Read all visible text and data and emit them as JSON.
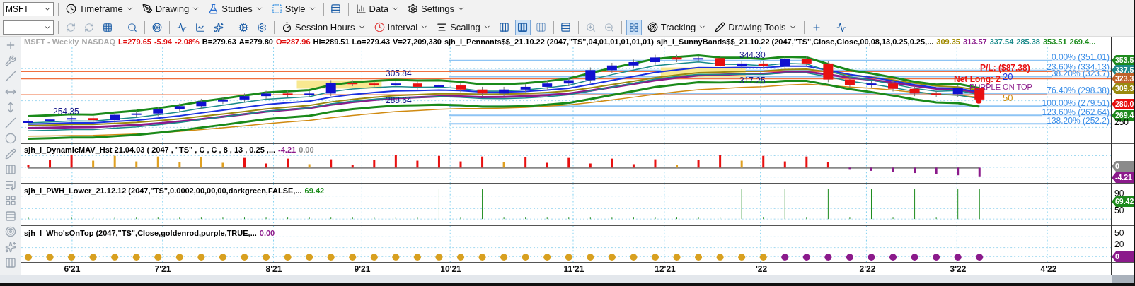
{
  "toolbar_row_1": {
    "symbol": "MSFT",
    "menus": [
      "Timeframe",
      "Drawing",
      "Studies",
      "Style",
      "Data",
      "Settings"
    ]
  },
  "toolbar_row_2": {
    "menus": [
      "Session Hours",
      "Interval",
      "Scaling",
      "Tracking",
      "Drawing Tools"
    ],
    "chart_styles": [
      {
        "selected": false
      },
      {
        "selected": true
      },
      {
        "selected": false
      }
    ],
    "crosshair_grid": {
      "selected": true
    }
  },
  "price_header": {
    "items": [
      {
        "text": "MSFT - Weekly",
        "color": "#a8a8a8"
      },
      {
        "text": "NASDAQ",
        "color": "#a8a8a8"
      },
      {
        "text": "L=279.65",
        "color": "#e01010"
      },
      {
        "text": "-5.94",
        "color": "#e01010"
      },
      {
        "text": "-2.08%",
        "color": "#e01010"
      },
      {
        "text": "B=279.63",
        "color": "#000000"
      },
      {
        "text": "A=279.80",
        "color": "#000000"
      },
      {
        "text": "O=287.96",
        "color": "#e01010"
      },
      {
        "text": "Hi=289.51",
        "color": "#000000"
      },
      {
        "text": "Lo=279.43",
        "color": "#000000"
      },
      {
        "text": "V=27,209,330",
        "color": "#000000"
      },
      {
        "text": "sjh_I_Pennants$$_21.10.22 (2047,\"TS\",04,01,01,01,01,01)",
        "color": "#000000"
      },
      {
        "text": "sjh_I_SunnyBands$$_21.10.22 (2047,\"TS\",Close,Close,00,08,13,0.25,0.25,...",
        "color": "#000000"
      },
      {
        "text": "309.35",
        "color": "#a08a00"
      },
      {
        "text": "313.57",
        "color": "#8b1a8b"
      },
      {
        "text": "337.54",
        "color": "#1a8a8a"
      },
      {
        "text": "285.38",
        "color": "#1a8a8a"
      },
      {
        "text": "353.51",
        "color": "#1a8a1a"
      },
      {
        "text": "269.4...",
        "color": "#1a8a1a"
      }
    ]
  },
  "price_labels": [
    {
      "text": "254.35"
    },
    {
      "text": "305.84"
    },
    {
      "text": "288.64"
    },
    {
      "text": "344.30"
    },
    {
      "text": "317.25"
    }
  ],
  "fib_levels": [
    "0.00% (351.01)",
    "23.60% (334.13)",
    "38.20% (323.7)",
    "76.40% (298.38)",
    "100.00% (279.51)",
    "123.60% (262.64)",
    "138.20% (252.2)"
  ],
  "trade_info": {
    "pl": "P/L: ($87.38)",
    "position": "Net Long: 2",
    "count_20": "20",
    "who_on_top": "PURPLE ON TOP",
    "count_50": "50"
  },
  "price_axis": {
    "tags": [
      {
        "text": "353.5",
        "color": "#1e8a1e"
      },
      {
        "text": "337.5",
        "color": "#1f8a8a"
      },
      {
        "text": "323.3",
        "color": "#c0622a"
      },
      {
        "text": "309.3",
        "color": "#9a8a10"
      },
      {
        "text": "280.0",
        "color": "#e81010"
      },
      {
        "text": "269.4",
        "color": "#1e8a1e"
      }
    ],
    "ticks": [
      "250"
    ]
  },
  "indicators": [
    {
      "label": "sjh_I_DynamicMAV_Hst 21.04.03 ( 2047 , \"TS\" , C , C ,  8 , 13 , 0.25 ,...",
      "values": [
        {
          "text": "-4.21",
          "color": "#8b1a8b"
        },
        {
          "text": "0.00",
          "color": "#8a8a8a"
        }
      ],
      "tags": [
        {
          "text": "0",
          "color": "#8a8a8a"
        },
        {
          "text": "-4.21",
          "color": "#8b1a8b"
        }
      ]
    },
    {
      "label": "sjh_I_PWH_Lower_21.12.12 (2047,\"TS\",0.0002,00,00,00,darkgreen,FALSE,...",
      "values": [
        {
          "text": "69.42",
          "color": "#1a8a1a"
        }
      ],
      "ticks": [
        "90",
        "50"
      ],
      "tags": [
        {
          "text": "69.42",
          "color": "#1e8a1e"
        }
      ]
    },
    {
      "label": "sjh_I_Who'sOnTop (2047,\"TS\",Close,goldenrod,purple,TRUE,...",
      "values": [
        {
          "text": "0.00",
          "color": "#8b1a8b"
        }
      ],
      "ticks": [
        "50",
        "20"
      ],
      "tags": [
        {
          "text": "0",
          "color": "#8b1a8b"
        }
      ]
    }
  ],
  "x_axis": [
    "6'21",
    "7'21",
    "8'21",
    "9'21",
    "10'21",
    "11'21",
    "12'21",
    "'22",
    "2'22",
    "3'22",
    "4'22"
  ]
}
